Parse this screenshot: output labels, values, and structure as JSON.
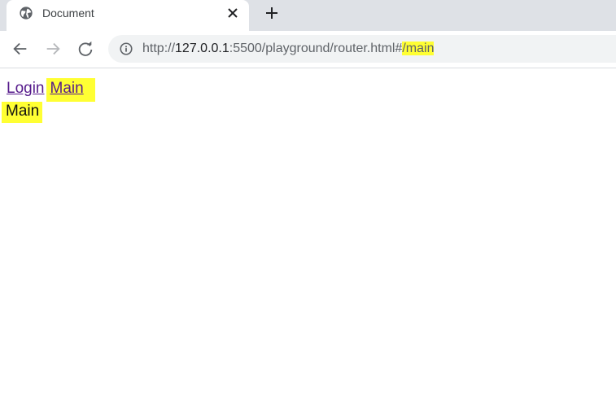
{
  "browser": {
    "tab": {
      "title": "Document",
      "favicon": "globe-icon",
      "close_icon": "close-icon"
    },
    "new_tab_icon": "plus-icon",
    "toolbar": {
      "back_icon": "back-arrow-icon",
      "forward_icon": "forward-arrow-icon",
      "reload_icon": "reload-icon",
      "info_icon": "info-icon"
    },
    "address": {
      "scheme": "http://",
      "host": "127.0.0.1",
      "path": ":5500/playground/router.html#",
      "fragment": "/main"
    }
  },
  "page": {
    "links": [
      "Login",
      "Main"
    ],
    "view_text": "Main"
  },
  "colors": {
    "highlight": "#ffff33",
    "link_visited": "#551a8b",
    "tabstrip": "#dee1e6",
    "omnibox": "#f1f3f4"
  }
}
